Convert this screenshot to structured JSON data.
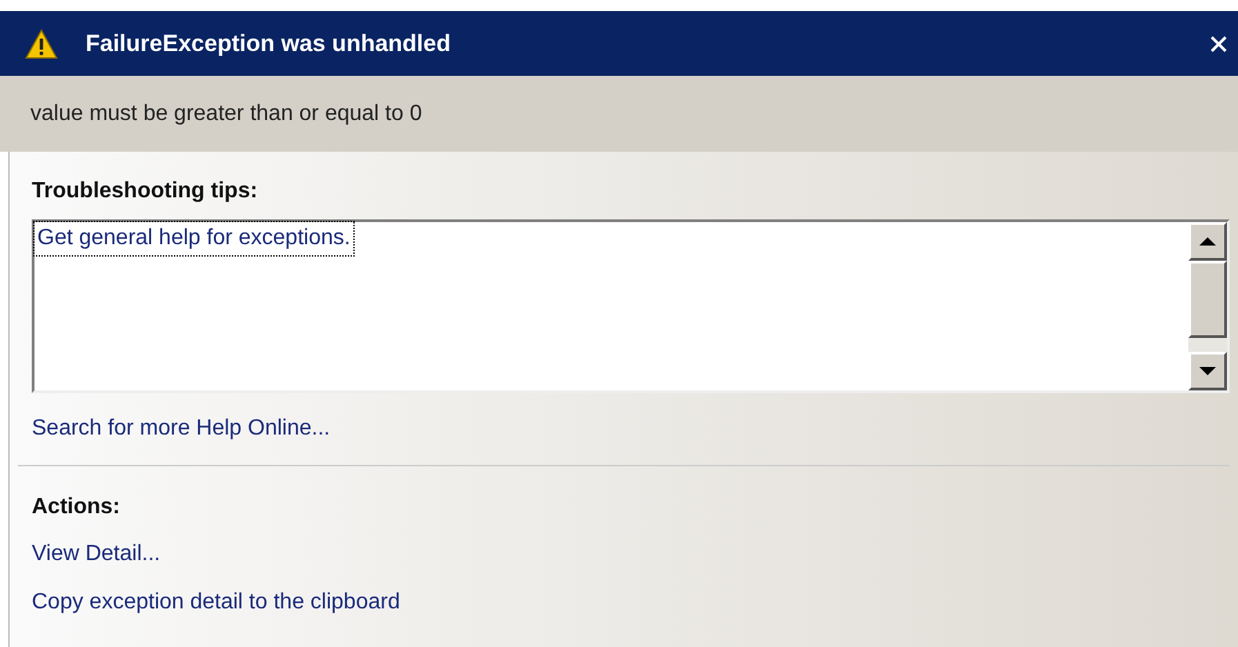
{
  "window": {
    "title": "FailureException was unhandled"
  },
  "message": "value must be greater than or equal to 0",
  "troubleshooting": {
    "heading": "Troubleshooting tips:",
    "tips": [
      {
        "label": "Get general help for exceptions.",
        "focused": true
      }
    ],
    "more_help_link": "Search for more Help Online..."
  },
  "actions": {
    "heading": "Actions:",
    "links": [
      "View Detail...",
      "Copy exception detail to the clipboard"
    ]
  }
}
